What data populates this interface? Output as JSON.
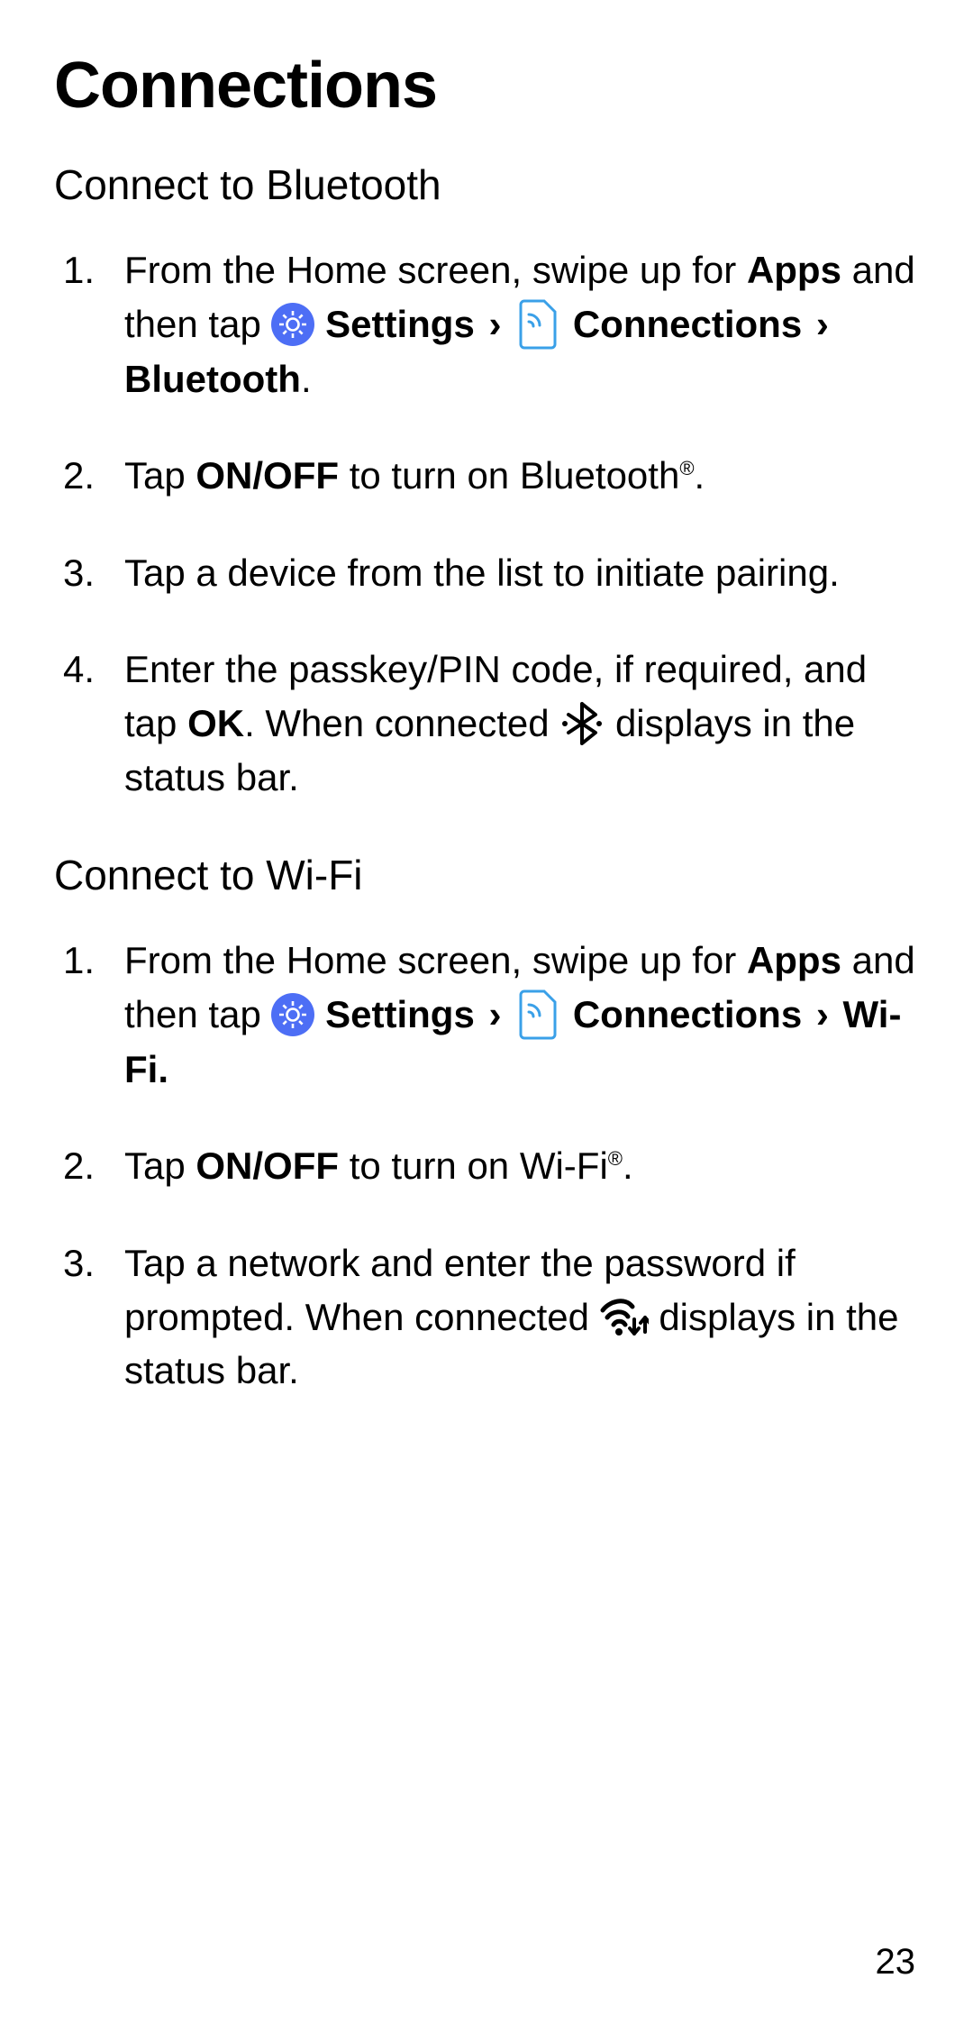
{
  "title": "Connections",
  "page_number": "23",
  "sections": [
    {
      "heading": "Connect to Bluetooth",
      "steps": [
        {
          "num": "1.",
          "pre": "From the Home screen, swipe up for ",
          "apps": "Apps",
          "mid": " and then tap ",
          "settings": "Settings",
          "chev1": "›",
          "connections": "Connections",
          "chev2": "›",
          "target": "Bluetooth",
          "period": "."
        },
        {
          "num": "2.",
          "pre": "Tap ",
          "onoff": "ON/OFF",
          "post": " to turn on Bluetooth",
          "reg": "®",
          "period": "."
        },
        {
          "num": "3.",
          "text": "Tap a device from the list to initiate pairing."
        },
        {
          "num": "4.",
          "pre": "Enter the passkey/PIN code, if required, and tap ",
          "ok": "OK",
          "mid": ". When connected ",
          "post": " displays in the status bar."
        }
      ]
    },
    {
      "heading": "Connect to Wi-Fi",
      "steps": [
        {
          "num": "1.",
          "pre": "From the Home screen, swipe up for ",
          "apps": "Apps",
          "mid": " and then tap ",
          "settings": "Settings",
          "chev1": "›",
          "connections": "Connections",
          "chev2": "›",
          "target": "Wi-Fi.",
          "period": ""
        },
        {
          "num": "2.",
          "pre": "Tap ",
          "onoff": "ON/OFF",
          "post": " to turn on Wi-Fi",
          "reg": "®",
          "period": "."
        },
        {
          "num": "3.",
          "pre": "Tap a network and enter the password if prompted. When connected ",
          "post": " displays in the status bar."
        }
      ]
    }
  ]
}
